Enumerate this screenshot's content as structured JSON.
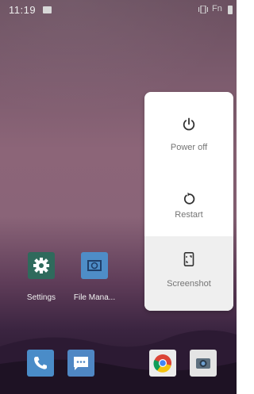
{
  "status_bar": {
    "time": "11:19",
    "fn_label": "Fn",
    "icons": [
      "image-icon",
      "vibrate-icon",
      "battery-icon"
    ]
  },
  "power_menu": {
    "items": [
      {
        "label": "Power off",
        "icon": "power-icon"
      },
      {
        "label": "Restart",
        "icon": "restart-icon"
      },
      {
        "label": "Screenshot",
        "icon": "screenshot-icon"
      }
    ]
  },
  "home": {
    "apps": [
      {
        "label": "Settings",
        "icon": "gear-icon"
      },
      {
        "label": "File Mana...",
        "icon": "folder-icon"
      }
    ],
    "dock": [
      {
        "icon": "phone-icon"
      },
      {
        "icon": "messages-icon"
      },
      {
        "icon": "chrome-icon"
      },
      {
        "icon": "camera-icon"
      }
    ]
  },
  "colors": {
    "menu_background": "#ffffff",
    "menu_selected": "#efefef",
    "menu_text": "#757575",
    "settings_tile": "#2f6a5c",
    "files_tile": "#4e8dc7"
  }
}
